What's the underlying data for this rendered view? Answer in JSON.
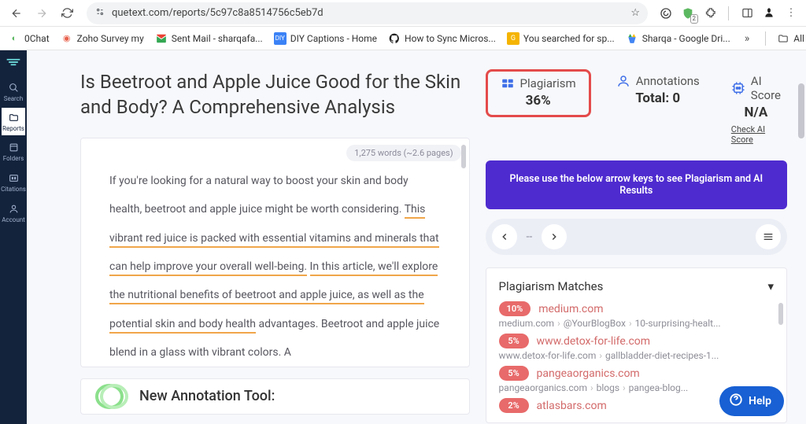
{
  "browser": {
    "url": "quetext.com/reports/5c97c8a8514756c5eb7d",
    "bookmarks": [
      "0Chat",
      "Zoho Survey my",
      "Sent Mail - sharqafa...",
      "DIY Captions - Home",
      "How to Sync Micros...",
      "You searched for sp...",
      "Sharqa - Google Dri..."
    ],
    "all_bookmarks": "All Bookmarks",
    "ext_badge": "2"
  },
  "rail": {
    "items": [
      "Search",
      "Reports",
      "Folders",
      "Citations",
      "Account"
    ]
  },
  "report": {
    "title": "Is Beetroot and Apple Juice Good for the Skin and Body? A Comprehensive Analysis",
    "word_pill": "1,275 words (~2.6 pages)",
    "body_plain": "If you're looking for a natural way to boost your skin and body health, beetroot and apple juice might be worth considering. ",
    "body_hl1": "This vibrant red juice is packed with essential vitamins and minerals that can help improve your overall well-being.",
    "body_mid": " ",
    "body_hl2": "In this article, we'll explore the nutritional benefits of beetroot and apple juice, as well as the potential skin and body health",
    "body_tail": " advantages. Beetroot and apple juice blend in a glass with vibrant colors. A",
    "annot_tool": "New Annotation Tool:"
  },
  "metrics": {
    "plagiarism_label": "Plagiarism",
    "plagiarism_value": "36%",
    "annotations_label": "Annotations",
    "annotations_value": "Total: 0",
    "ai_label": "AI Score",
    "ai_value": "N/A",
    "ai_sub": "Check AI Score"
  },
  "banner": "Please use the below arrow keys to see Plagiarism and AI Results",
  "pager_dash": "--",
  "matches": {
    "title": "Plagiarism Matches",
    "items": [
      {
        "pct": "10%",
        "domain": "medium.com",
        "crumb": [
          "medium.com",
          "@YourBlogBox",
          "10-surprising-healt..."
        ]
      },
      {
        "pct": "5%",
        "domain": "www.detox-for-life.com",
        "crumb": [
          "www.detox-for-life.com",
          "gallbladder-diet-recipes-1..."
        ]
      },
      {
        "pct": "5%",
        "domain": "pangeaorganics.com",
        "crumb": [
          "pangeaorganics.com",
          "blogs",
          "pangea-blog..."
        ]
      },
      {
        "pct": "2%",
        "domain": "atlasbars.com",
        "crumb": []
      }
    ]
  },
  "help": "Help"
}
